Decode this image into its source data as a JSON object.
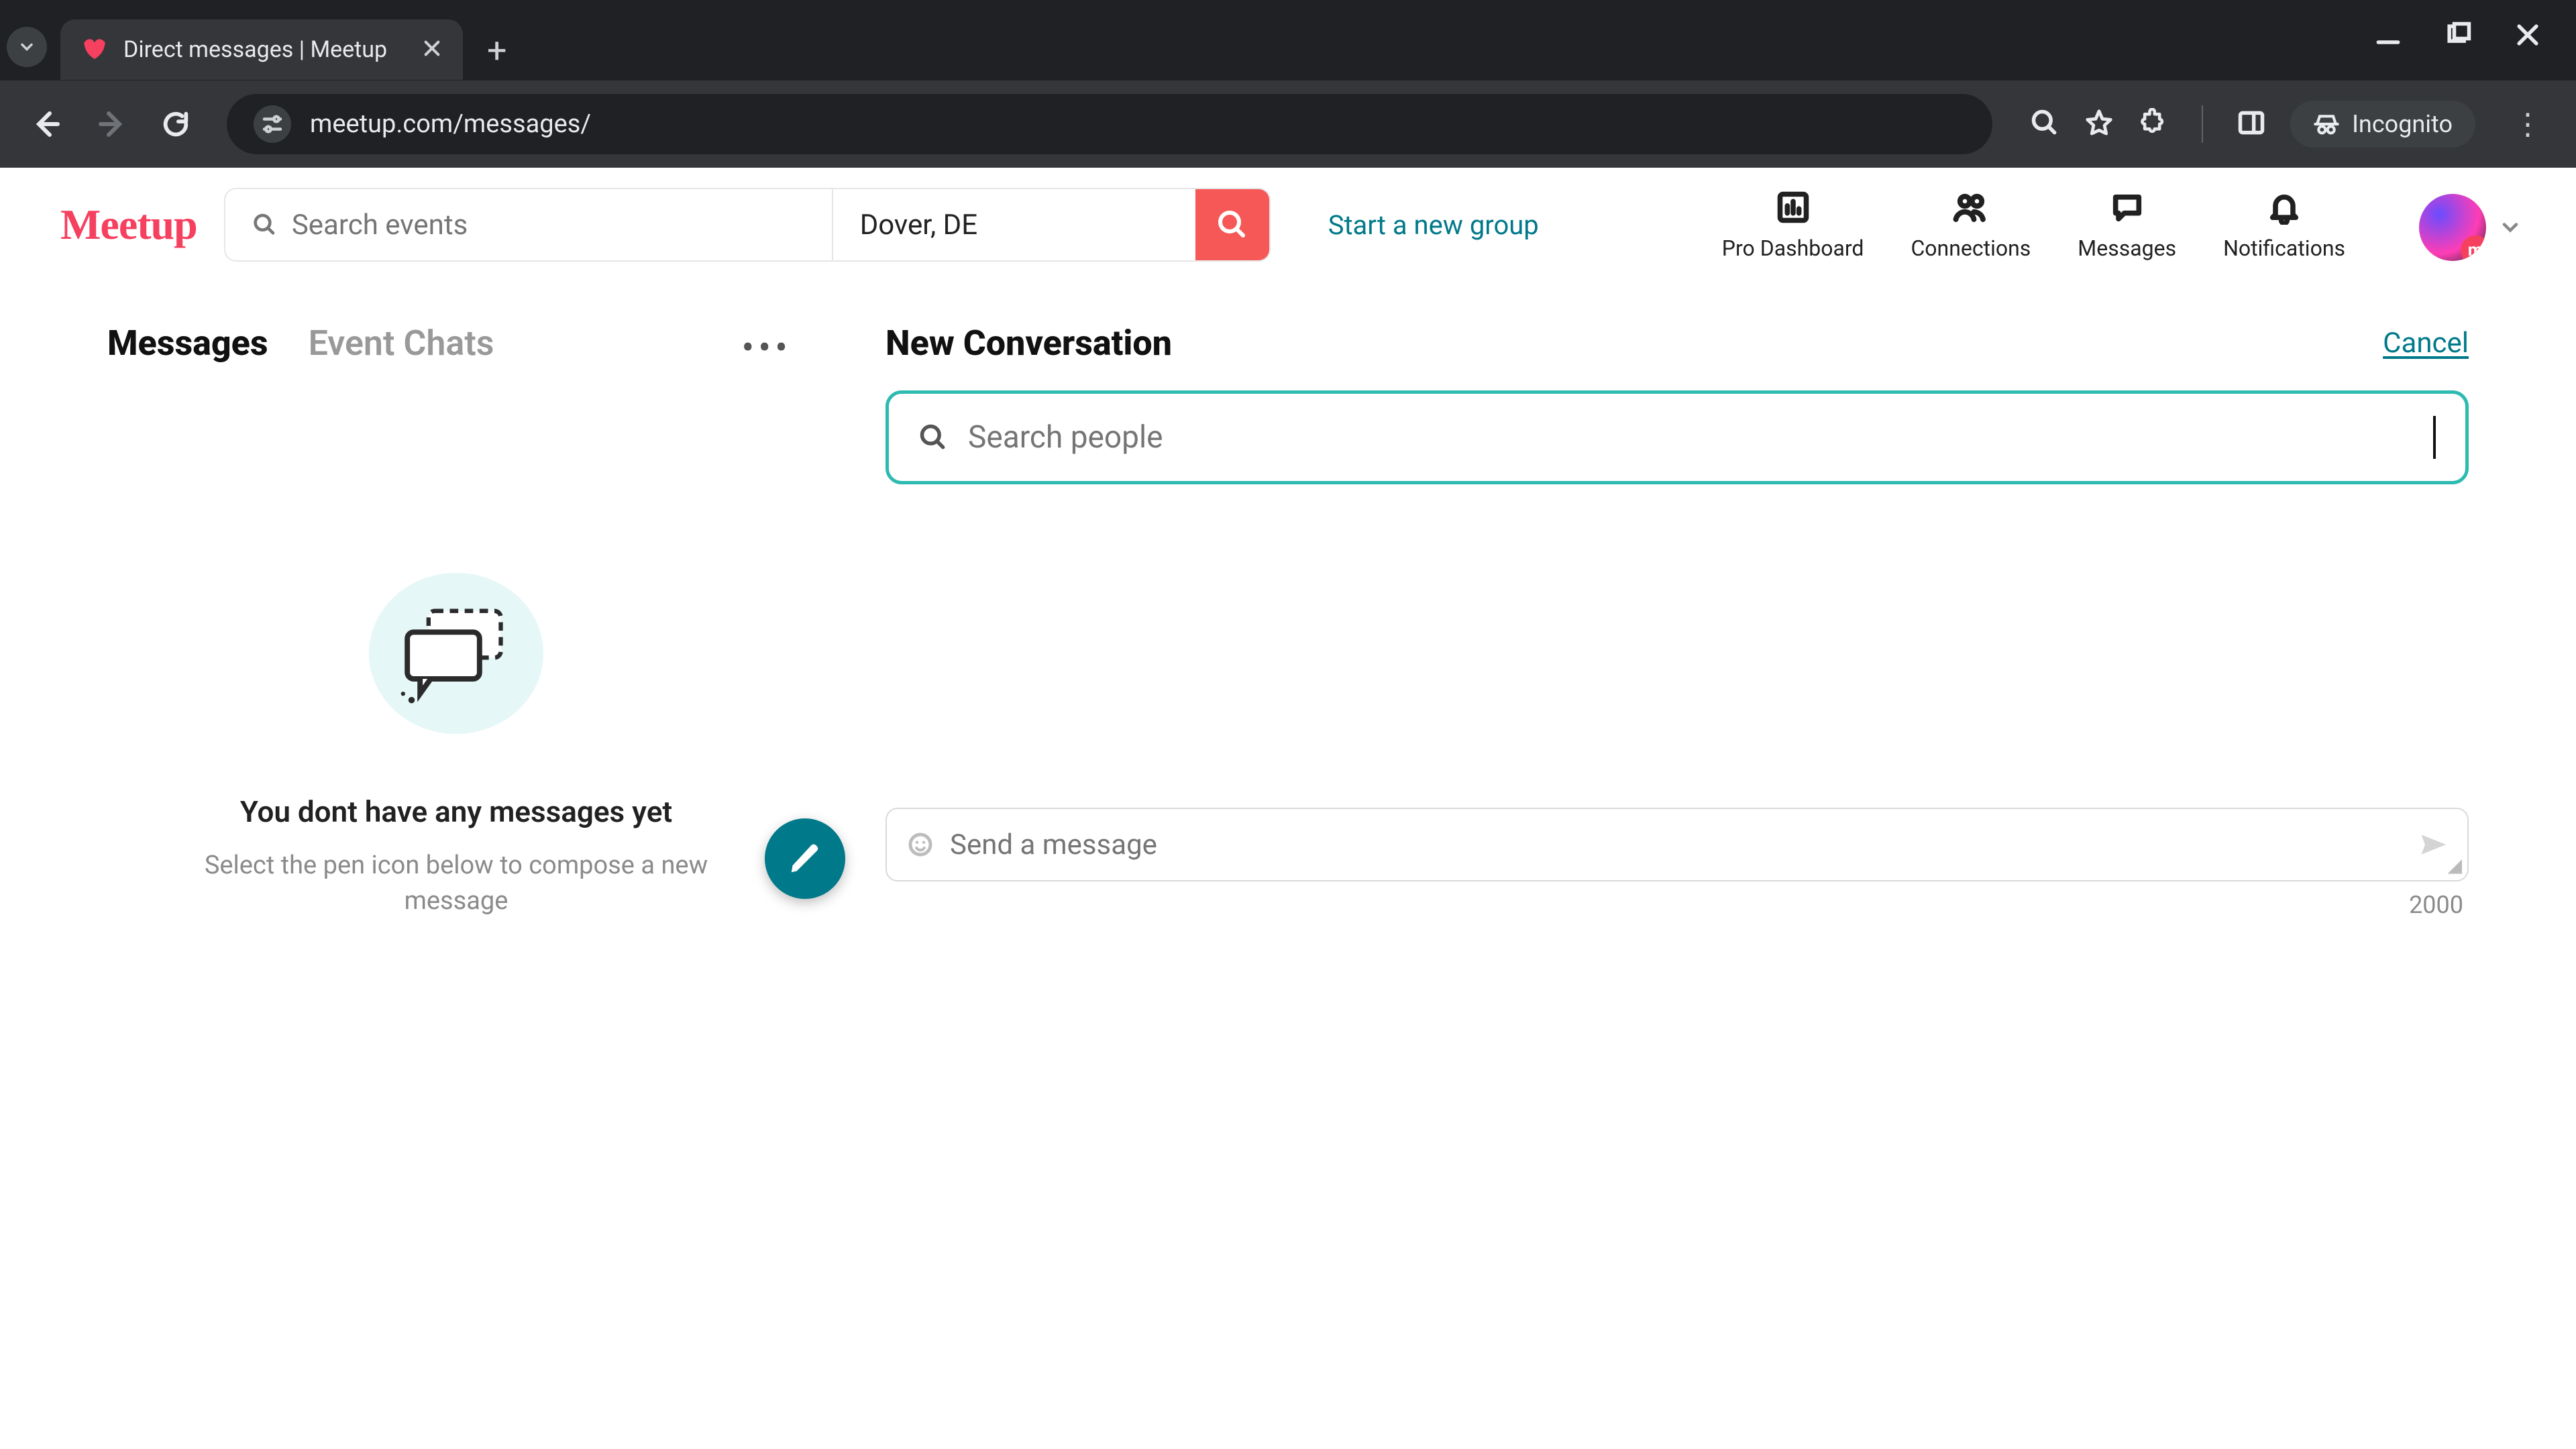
{
  "browser": {
    "tab_title": "Direct messages | Meetup",
    "url": "meetup.com/messages/",
    "incognito_label": "Incognito"
  },
  "header": {
    "logo_text": "Meetup",
    "search_placeholder": "Search events",
    "location": "Dover, DE",
    "start_group": "Start a new group",
    "nav": {
      "pro": "Pro Dashboard",
      "connections": "Connections",
      "messages": "Messages",
      "notifications": "Notifications"
    }
  },
  "left": {
    "tabs": {
      "messages": "Messages",
      "event_chats": "Event Chats"
    },
    "empty_title": "You dont have any messages yet",
    "empty_sub": "Select the pen icon below to compose a new message"
  },
  "right": {
    "title": "New Conversation",
    "cancel": "Cancel",
    "search_placeholder": "Search people",
    "message_placeholder": "Send a message",
    "char_limit": "2000"
  }
}
